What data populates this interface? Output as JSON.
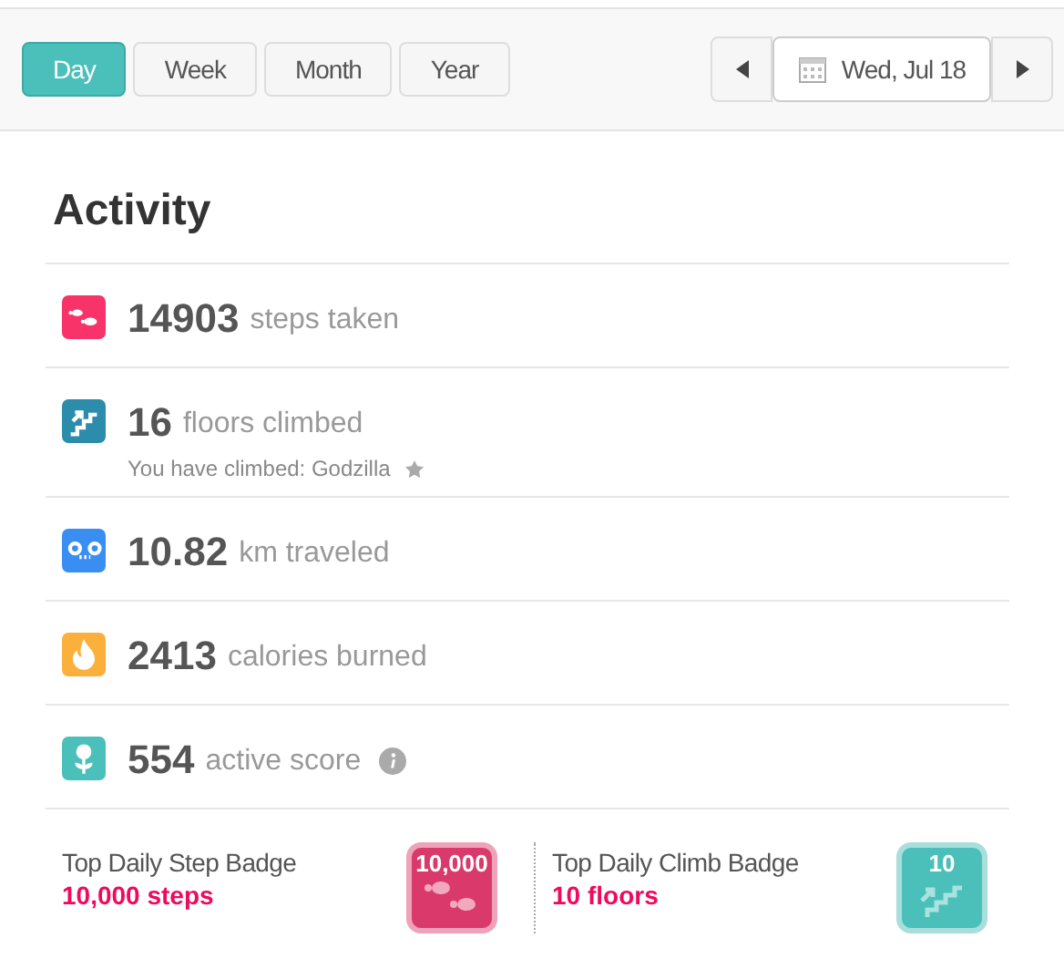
{
  "range_tabs": [
    {
      "label": "Day",
      "selected": true
    },
    {
      "label": "Week",
      "selected": false
    },
    {
      "label": "Month",
      "selected": false
    },
    {
      "label": "Year",
      "selected": false
    }
  ],
  "date": "Wed, Jul 18",
  "title": "Activity",
  "metrics": [
    {
      "kind": "steps",
      "color": "#f7336a",
      "value": "14903",
      "label": "steps taken"
    },
    {
      "kind": "floors",
      "color": "#2b8cab",
      "value": "16",
      "label": "floors climbed",
      "note": "You have climbed: Godzilla"
    },
    {
      "kind": "distance",
      "color": "#3a8ef2",
      "value": "10.82",
      "label": "km traveled"
    },
    {
      "kind": "calories",
      "color": "#fbb03b",
      "value": "2413",
      "label": "calories burned"
    },
    {
      "kind": "score",
      "color": "#4bbfba",
      "value": "554",
      "label": "active score"
    }
  ],
  "badges": [
    {
      "kind": "steps",
      "title": "Top Daily Step Badge",
      "value": "10,000 steps",
      "badge_text": "10,000"
    },
    {
      "kind": "floors",
      "title": "Top Daily Climb Badge",
      "value": "10 floors",
      "badge_text": "10"
    }
  ]
}
